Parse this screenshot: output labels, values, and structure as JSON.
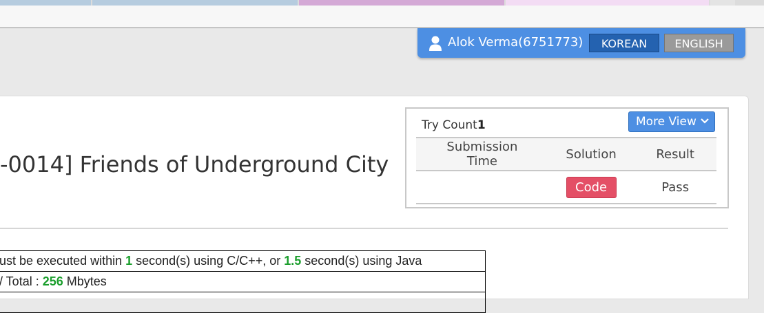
{
  "browser": {
    "tab_colors": [
      "#b6ccdf",
      "#b6ccdf",
      "#d4a9d6",
      "#f3dcf4",
      "#e4e4e4"
    ]
  },
  "user_bar": {
    "user_name": "Alok Verma(6751773)",
    "lang_korean": "KOREAN",
    "lang_english": "ENGLISH",
    "accent_color": "#4d8fe3"
  },
  "problem": {
    "title": "-0014] Friends of Underground City"
  },
  "submissions": {
    "try_count_label": "Try Count",
    "try_count_value": "1",
    "more_view_label": "More View",
    "columns": [
      "Submission Time",
      "Solution",
      "Result"
    ],
    "rows": [
      {
        "submission_time": "",
        "solution": "Code",
        "result": "Pass"
      }
    ]
  },
  "limits": {
    "time_prefix": "ust be executed within ",
    "time_cpp": "1",
    "time_mid": " second(s) using C/C++, or ",
    "time_java": "1.5",
    "time_suffix": " second(s) using Java",
    "mem_prefix": " / Total : ",
    "mem_value": "256",
    "mem_suffix": " Mbytes"
  }
}
